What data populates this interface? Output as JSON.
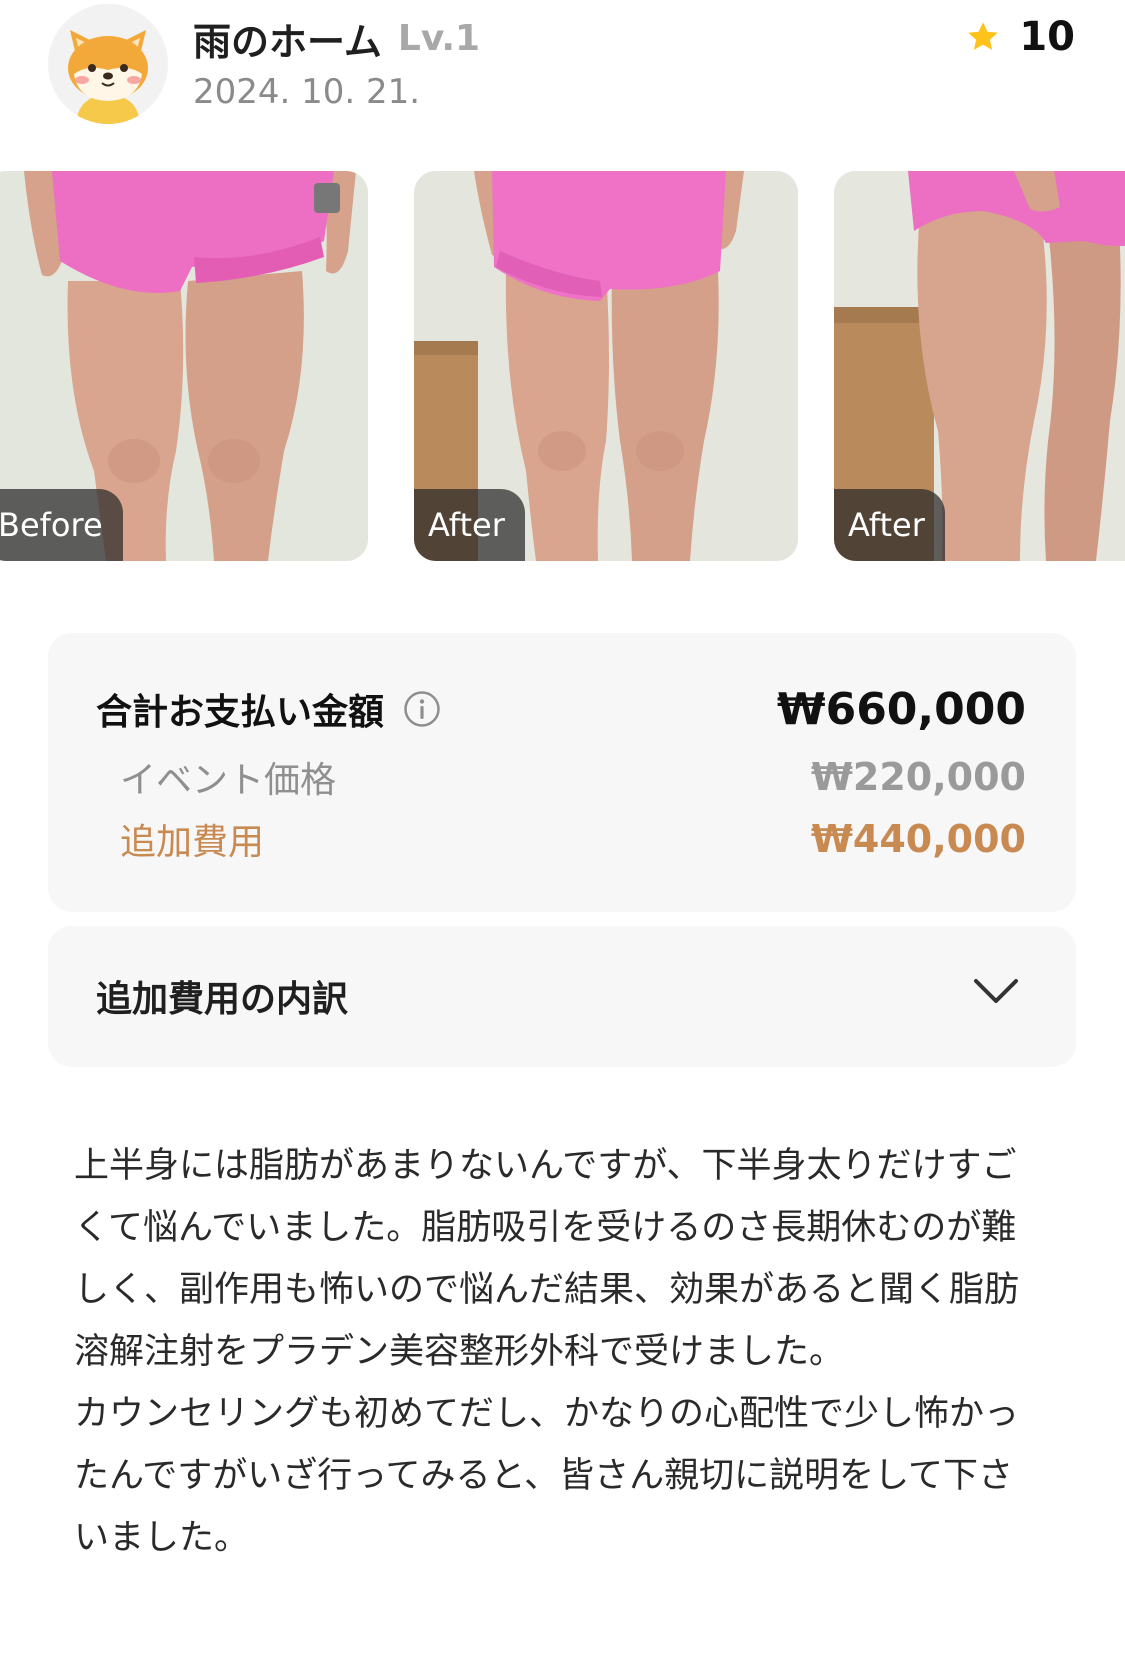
{
  "header": {
    "avatar_icon": "shiba-dog-avatar-icon",
    "username": "雨のホーム",
    "level": "Lv.1",
    "date": "2024. 10. 21.",
    "rating_icon": "star-icon",
    "rating_value": "10"
  },
  "photos": [
    {
      "tag": "Before"
    },
    {
      "tag": "After"
    },
    {
      "tag": "After"
    }
  ],
  "price": {
    "total_label": "合計お支払い金額",
    "info_icon": "info-circle-icon",
    "total_amount": "₩660,000",
    "event_label": "イベント価格",
    "event_amount": "₩220,000",
    "extra_label": "追加費用",
    "extra_amount": "₩440,000",
    "extra_color": "#c98a52"
  },
  "breakdown": {
    "title": "追加費用の内訳",
    "toggle_icon": "chevron-down-icon"
  },
  "review": {
    "text": "上半身には脂肪があまりないんですが、下半身太りだけすごくて悩んでいました。脂肪吸引を受けるのさ長期休むのが難しく、副作用も怖いので悩んだ結果、効果があると聞く脂肪溶解注射をプラデン美容整形外科で受けました。\nカウンセリングも初めてだし、かなりの心配性で少し怖かったんですがいざ行ってみると、皆さん親切に説明をして下さいました。"
  }
}
